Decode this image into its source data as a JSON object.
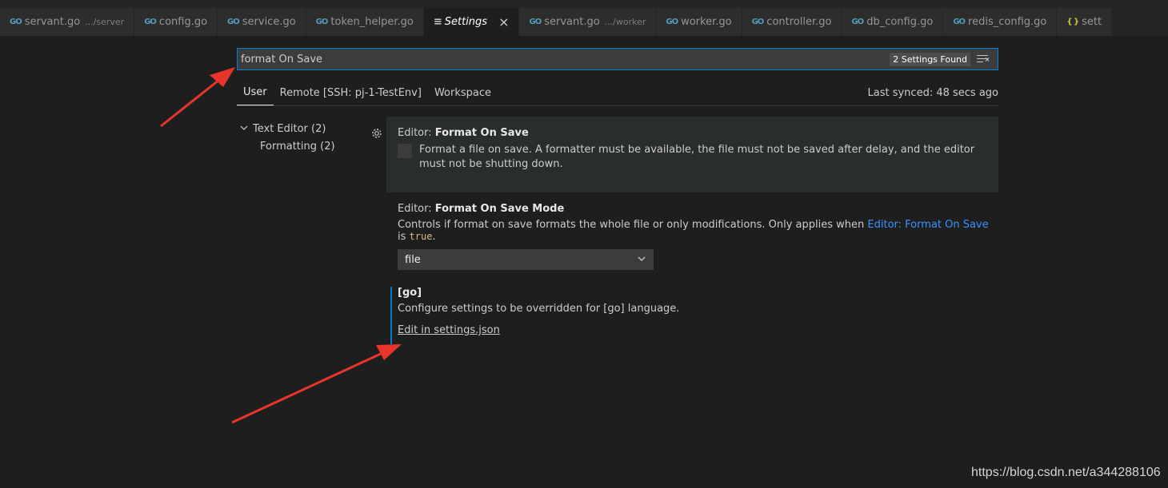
{
  "tabs": [
    {
      "icon": "go-file-icon",
      "name": "servant.go",
      "desc": ".../server",
      "active": false
    },
    {
      "icon": "go-file-icon",
      "name": "config.go",
      "desc": "",
      "active": false
    },
    {
      "icon": "go-file-icon",
      "name": "service.go",
      "desc": "",
      "active": false
    },
    {
      "icon": "go-file-icon",
      "name": "token_helper.go",
      "desc": "",
      "active": false
    },
    {
      "icon": "settings-icon",
      "name": "Settings",
      "desc": "",
      "active": true
    },
    {
      "icon": "go-file-icon",
      "name": "servant.go",
      "desc": ".../worker",
      "active": false
    },
    {
      "icon": "go-file-icon",
      "name": "worker.go",
      "desc": "",
      "active": false
    },
    {
      "icon": "go-file-icon",
      "name": "controller.go",
      "desc": "",
      "active": false
    },
    {
      "icon": "go-file-icon",
      "name": "db_config.go",
      "desc": "",
      "active": false
    },
    {
      "icon": "go-file-icon",
      "name": "redis_config.go",
      "desc": "",
      "active": false
    },
    {
      "icon": "json-file-icon",
      "name": "sett",
      "desc": "",
      "active": false
    }
  ],
  "tab_icon_glyphs": {
    "go": "GO",
    "json": "{ }",
    "settings": "≡",
    "close": "×"
  },
  "search": {
    "value": "format On Save",
    "results_badge": "2 Settings Found"
  },
  "scopes": {
    "user": "User",
    "remote": "Remote [SSH: pj-1-TestEnv]",
    "workspace": "Workspace",
    "active": "User",
    "last_synced": "Last synced: 48 secs ago"
  },
  "toc": {
    "text_editor": "Text Editor (2)",
    "formatting": "Formatting (2)"
  },
  "settings": {
    "format_on_save": {
      "category": "Editor: ",
      "name": "Format On Save",
      "description": "Format a file on save. A formatter must be available, the file must not be saved after delay, and the editor must not be shutting down.",
      "checked": false
    },
    "format_on_save_mode": {
      "category": "Editor: ",
      "name": "Format On Save Mode",
      "description_prefix": "Controls if format on save formats the whole file or only modifications. Only applies when ",
      "description_link": "Editor: Format On Save",
      "description_middle": " is ",
      "description_code": "true",
      "description_suffix": ".",
      "selected": "file"
    },
    "go_override": {
      "title": "[go]",
      "description": "Configure settings to be overridden for [go] language.",
      "link": "Edit in settings.json"
    }
  },
  "watermark": "https://blog.csdn.net/a344288106",
  "colors": {
    "editor_bg": "#1e1e1e",
    "tab_inactive_bg": "#2d2d2d",
    "focus_border": "#007fd4",
    "link": "#3794ff",
    "go_icon": "#519aba",
    "annotation_arrow": "#e8352b"
  }
}
